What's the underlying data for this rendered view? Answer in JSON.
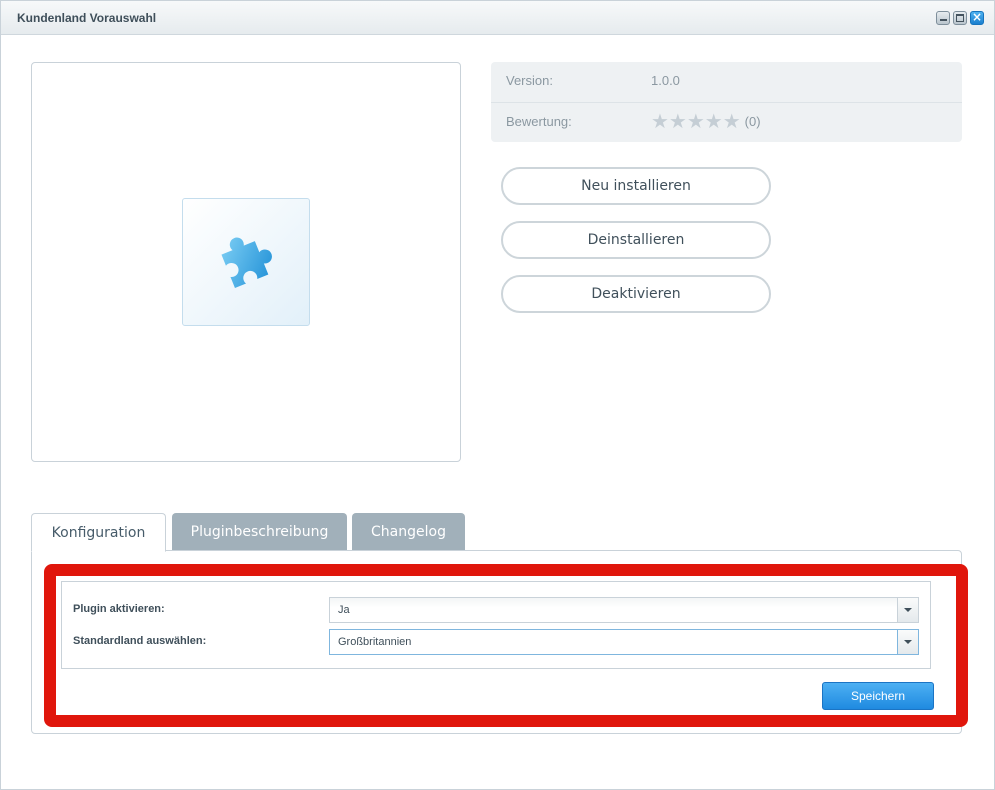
{
  "window": {
    "title": "Kundenland Vorauswahl",
    "controls": {
      "minimize": "minimize-icon",
      "maximize": "maximize-icon",
      "close": "close-icon"
    }
  },
  "preview": {
    "icon": "puzzle-piece-icon",
    "icon_color": "#3aa8e3"
  },
  "info": {
    "version_label": "Version:",
    "version_value": "1.0.0",
    "rating_label": "Bewertung:",
    "rating_stars": "★★★★★",
    "rating_value": 0,
    "rating_count": "(0)"
  },
  "actions": {
    "reinstall": "Neu installieren",
    "uninstall": "Deinstallieren",
    "deactivate": "Deaktivieren"
  },
  "tabs": [
    {
      "label": "Konfiguration",
      "active": true
    },
    {
      "label": "Pluginbeschreibung",
      "active": false
    },
    {
      "label": "Changelog",
      "active": false
    }
  ],
  "config": {
    "fields": [
      {
        "label": "Plugin aktivieren:",
        "value": "Ja"
      },
      {
        "label": "Standardland auswählen:",
        "value": "Großbritannien"
      }
    ],
    "save_label": "Speichern"
  },
  "colors": {
    "highlight": "#e0160c",
    "accent": "#1f8ae0",
    "tab_inactive": "#a1b0ba"
  }
}
